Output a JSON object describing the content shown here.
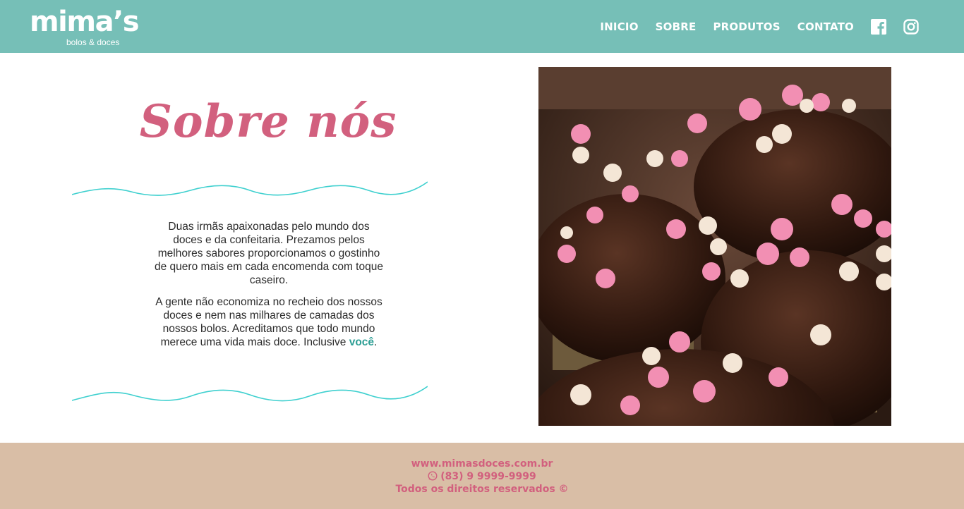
{
  "header": {
    "logo_name": "mima’s",
    "logo_tagline": "bolos & doces",
    "nav": [
      {
        "label": "INICIO"
      },
      {
        "label": "SOBRE"
      },
      {
        "label": "PRODUTOS"
      },
      {
        "label": "CONTATO"
      }
    ],
    "social_icons": [
      "facebook-icon",
      "instagram-icon"
    ]
  },
  "about": {
    "title": "Sobre nós",
    "paragraph1": "Duas irmãs apaixonadas pelo mundo dos doces e da confeitaria. Prezamos pelos melhores sabores proporcionamos o gostinho de quero mais em cada encomenda com toque caseiro.",
    "paragraph2_text": "A gente não economiza no recheio dos nossos doces e nem nas milhares de camadas dos nossos bolos. Acreditamos que todo mundo merece uma vida mais doce. Inclusive ",
    "paragraph2_highlight": "você",
    "paragraph2_end": "."
  },
  "photo": {
    "subject": "chocolate cupcakes with heart sprinkles"
  },
  "footer": {
    "website": "www.mimasdoces.com.br",
    "phone": "(83) 9 9999-9999",
    "copyright": "Todos os direitos reservados ©"
  },
  "colors": {
    "header_bg": "#76bfb7",
    "title_pink": "#d2607e",
    "wave_teal": "#3fd0cf",
    "footer_bg": "#d9bea6",
    "highlight_teal": "#2e9f95"
  }
}
